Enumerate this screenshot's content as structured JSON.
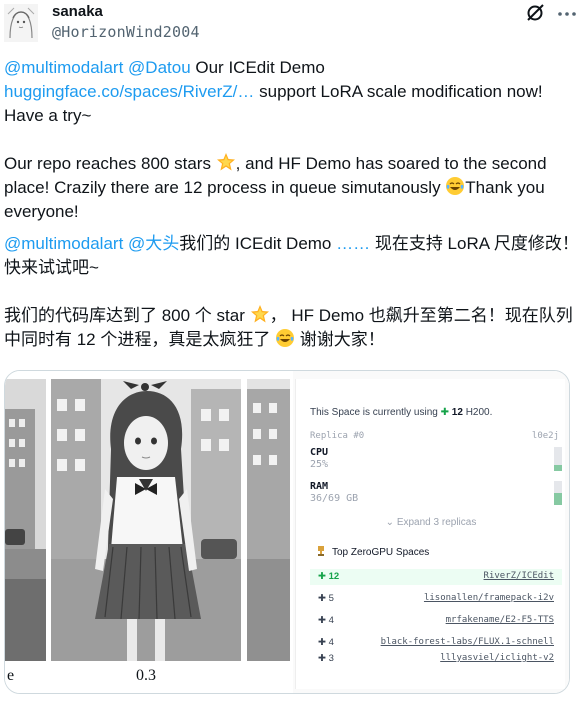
{
  "author": {
    "name": "sanaka",
    "handle": "@HorizonWind2004"
  },
  "icons": {
    "grok": "grok-icon",
    "more": "more-icon",
    "avatar": "avatar-anime-sketch"
  },
  "paragraphs": {
    "p1": {
      "mention1": "@multimodalart",
      "mention2": "@Datou",
      "text1": " Our ICEdit Demo",
      "link": "huggingface.co/spaces/RiverZ/…",
      "text2": " support LoRA scale modification now! Have a try~"
    },
    "p2": {
      "text1": "Our repo reaches 800 stars ",
      "text2": ", and HF Demo has soared to the second place! Crazily there are 12 process in queue simutanously ",
      "text3": "Thank you everyone!"
    },
    "p3": {
      "mention1": "@multimodalart",
      "mention2": "@大头",
      "text1": "我们的 ICEdit Demo  ",
      "link": "……",
      "text2": " 现在支持 LoRA 尺度修改！快来试试吧~"
    },
    "p4": {
      "text1": "我们的代码库达到了 800 个 star ",
      "text2": "， HF Demo 也飙升至第二名！现在队列中同时有 12 个进程，真是太疯狂了 ",
      "text3": " 谢谢大家！"
    }
  },
  "media": {
    "caption_left": "e",
    "caption_value": "0.3",
    "panel": {
      "space_prefix": "This Space is currently using ",
      "space_plus": "✚",
      "space_count": "12",
      "space_suffix": " H200.",
      "replica_label": "Replica #0",
      "replica_id": "l0e2j",
      "cpu_label": "CPU",
      "cpu_value": "25%",
      "cpu_usage": 0.25,
      "ram_label": "RAM",
      "ram_value": "36/69 GB",
      "ram_usage": 0.52,
      "expand_label": "⌄  Expand 3 replicas",
      "top_title": "Top ZeroGPU Spaces",
      "rows": [
        {
          "count": "✚ 12",
          "name": "RiverZ/ICEdit"
        },
        {
          "count": "✚ 5",
          "name": "lisonallen/framepack-i2v"
        },
        {
          "count": "✚ 4",
          "name": "mrfakename/E2-F5-TTS"
        },
        {
          "count": "✚ 4",
          "name": "black-forest-labs/FLUX.1-schnell"
        },
        {
          "count": "✚ 3",
          "name": "lllyasviel/iclight-v2"
        }
      ]
    }
  },
  "colors": {
    "link": "#1d9bf0",
    "handle": "#536471",
    "highlight_row": "#ecfdf3",
    "zero_gpu_green": "#16a34a"
  }
}
